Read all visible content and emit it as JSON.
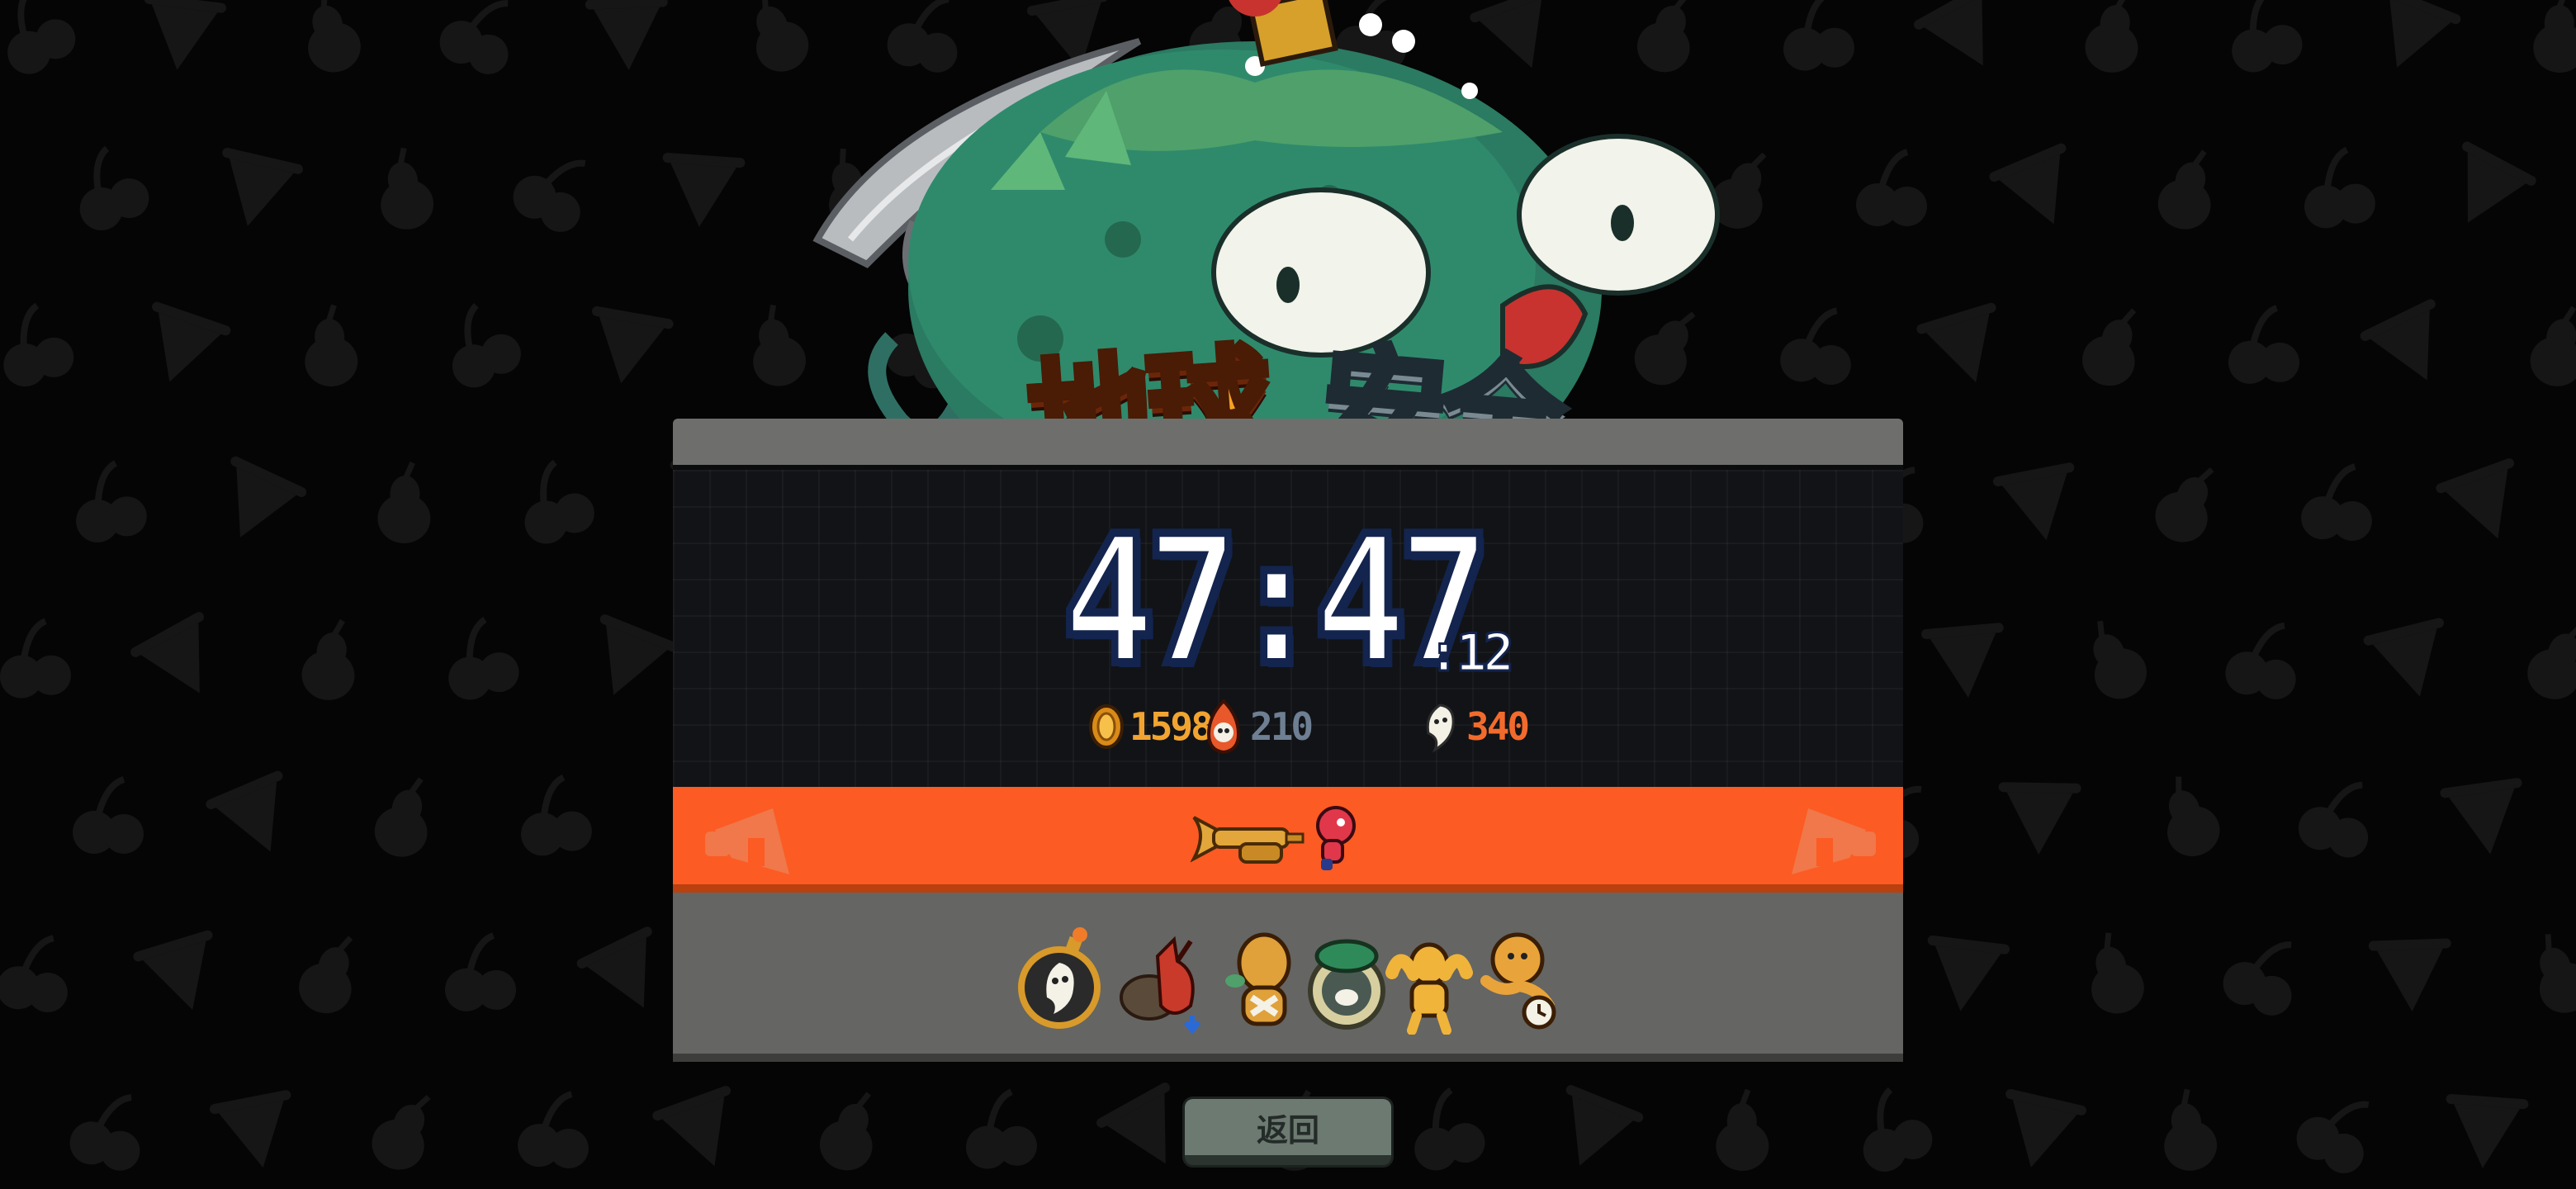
{
  "title": {
    "word_a": "地球",
    "word_b": "安全"
  },
  "timer": {
    "main": "47:47",
    "sub": ":12"
  },
  "stats": {
    "gold": "1598",
    "fire": "210",
    "ghost": "340"
  },
  "colors": {
    "background": "#050505",
    "panel_dark": "#111316",
    "panel_gray": "#656563",
    "band_orange": "#fc5b24",
    "gold_text": "#f2a431",
    "fire_text": "#6e7f93",
    "ghost_text": "#f26b2c",
    "button": "#6c7a72"
  },
  "icons": {
    "gold": "coin-icon",
    "fire": "fire-skull-icon",
    "ghost": "ghost-icon",
    "band_left": "megaphone-icon",
    "band_right": "megaphone-icon",
    "band_center": [
      "trumpet-icon",
      "red-character-icon"
    ],
    "items": [
      "ghost-bomb-icon",
      "red-demon-icon",
      "golden-character-icon",
      "green-bag-icon",
      "flexing-golden-character-icon",
      "clock-character-icon"
    ]
  },
  "back_button": {
    "label": "返回"
  }
}
